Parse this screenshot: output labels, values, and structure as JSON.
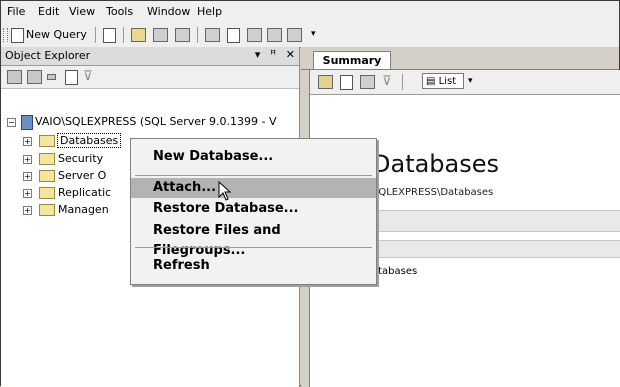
{
  "menubar": {
    "items": [
      "File",
      "Edit",
      "View",
      "Tools",
      "Window",
      "Help"
    ]
  },
  "toolbar": {
    "new_query_label": "New Query"
  },
  "object_explorer": {
    "title": "Object Explorer",
    "controls": "▾ ꟸ ✕",
    "server_node": "VAIO\\SQLEXPRESS (SQL Server 9.0.1399 - V",
    "children": [
      {
        "label": "Databases",
        "selected": true
      },
      {
        "label": "Security"
      },
      {
        "label": "Server O"
      },
      {
        "label": "Replicatic"
      },
      {
        "label": "Managen"
      }
    ]
  },
  "summary": {
    "tab_label": "Summary",
    "list_button_label": "List",
    "heading": "Databases",
    "path": "SQLEXPRESS\\Databases",
    "list_item": "atabases"
  },
  "context_menu": {
    "items": [
      {
        "label": "New Database..."
      },
      {
        "label": "Attach...",
        "highlighted": true
      },
      {
        "label": "Restore Database..."
      },
      {
        "label": "Restore Files and Filegroups..."
      },
      {
        "label": "Refresh"
      }
    ]
  },
  "colors": {
    "frame_bg": "#d4d0c8",
    "menu_bg": "#efefef",
    "highlight": "#b3b3b3"
  }
}
